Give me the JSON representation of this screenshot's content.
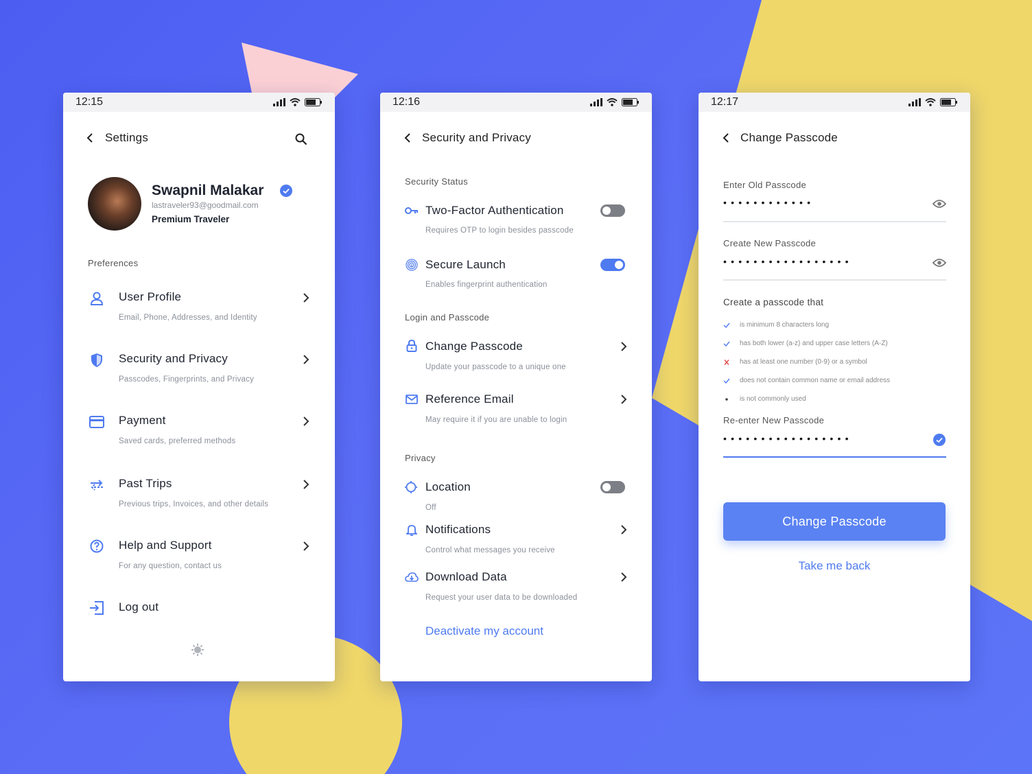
{
  "colors": {
    "accent": "#4f7bf0",
    "background": "#5566f3",
    "yellow": "#efd76a",
    "pink": "#fbd0d5"
  },
  "phone1": {
    "time": "12:15",
    "title": "Settings",
    "profile": {
      "name": "Swapnil Malakar",
      "email": "lastraveler93@goodmail.com",
      "tier": "Premium Traveler"
    },
    "section": "Preferences",
    "items": [
      {
        "icon": "user-icon",
        "title": "User Profile",
        "sub": "Email, Phone, Addresses, and Identity"
      },
      {
        "icon": "shield-icon",
        "title": "Security and Privacy",
        "sub": "Passcodes, Fingerprints, and Privacy"
      },
      {
        "icon": "card-icon",
        "title": "Payment",
        "sub": "Saved cards, preferred methods"
      },
      {
        "icon": "trips-icon",
        "title": "Past Trips",
        "sub": "Previous trips, Invoices, and other details"
      },
      {
        "icon": "help-icon",
        "title": "Help and Support",
        "sub": "For any question, contact us"
      }
    ],
    "logout": "Log out"
  },
  "phone2": {
    "time": "12:16",
    "title": "Security and Privacy",
    "section_status": "Security Status",
    "two_factor": {
      "title": "Two-Factor Authentication",
      "sub": "Requires OTP to login besides passcode",
      "enabled": false
    },
    "secure_launch": {
      "title": "Secure Launch",
      "sub": "Enables fingerprint authentication",
      "enabled": true
    },
    "section_login": "Login and Passcode",
    "change_passcode": {
      "title": "Change Passcode",
      "sub": "Update your passcode to a unique one"
    },
    "reference_email": {
      "title": "Reference Email",
      "sub": "May require it if you are unable to login"
    },
    "section_privacy": "Privacy",
    "location": {
      "title": "Location",
      "sub": "Off",
      "enabled": false
    },
    "notifications": {
      "title": "Notifications",
      "sub": "Control what messages you receive"
    },
    "download": {
      "title": "Download Data",
      "sub": "Request your user data to be downloaded"
    },
    "deactivate": "Deactivate my account"
  },
  "phone3": {
    "time": "12:17",
    "title": "Change Passcode",
    "old_label": "Enter Old Passcode",
    "old_value": "••••••••••••",
    "new_label": "Create New Passcode",
    "new_value": "•••••••••••••••••",
    "rules_title": "Create a passcode that",
    "rules": [
      {
        "status": "pass",
        "text": "is minimum 8 characters long"
      },
      {
        "status": "pass",
        "text": "has both lower (a-z) and upper case letters (A-Z)"
      },
      {
        "status": "fail",
        "text": "has at least one number (0-9) or a symbol"
      },
      {
        "status": "pass",
        "text": "does not contain common name or email address"
      },
      {
        "status": "pending",
        "text": "is not commonly used"
      }
    ],
    "reenter_label": "Re-enter New Passcode",
    "reenter_value": "•••••••••••••••••",
    "button": "Change Passcode",
    "back": "Take me back"
  }
}
